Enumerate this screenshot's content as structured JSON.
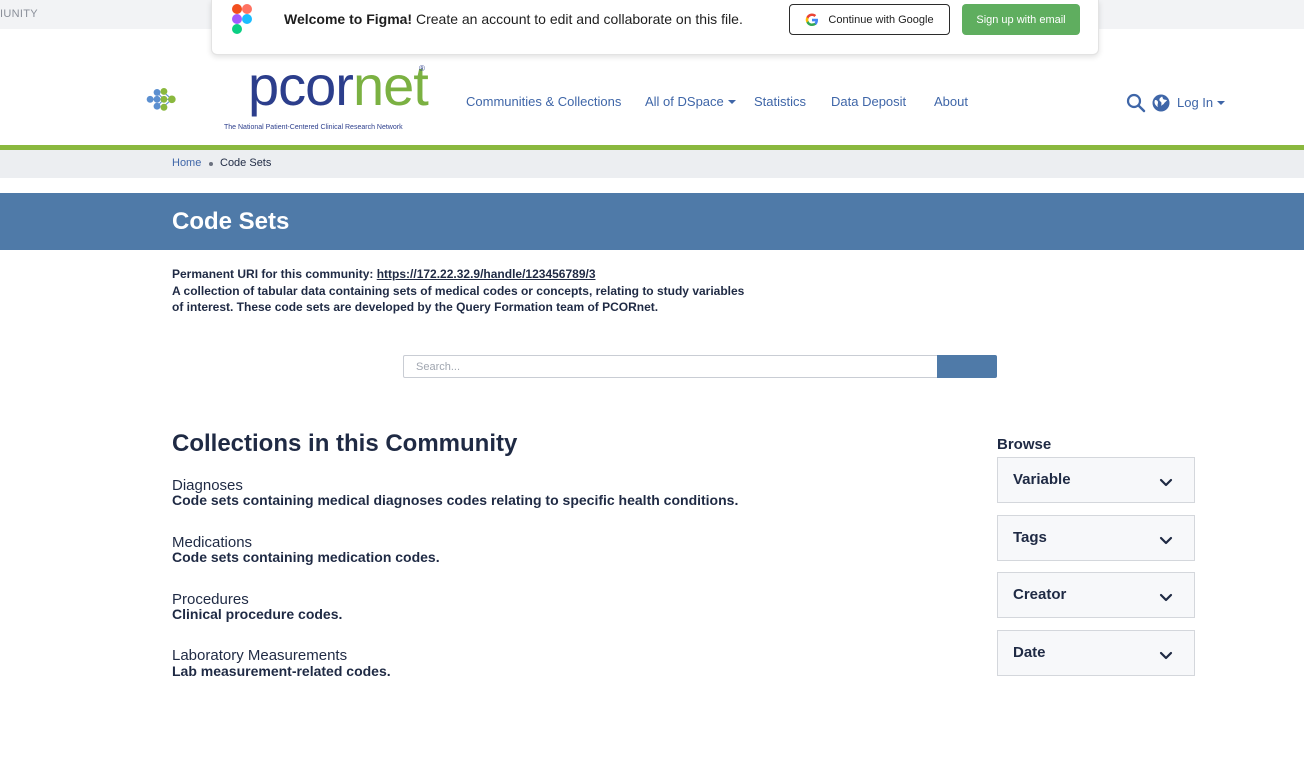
{
  "top_strip": {
    "text": "IUNITY"
  },
  "figma_banner": {
    "title": "Welcome to Figma!",
    "message": "Create an account to edit and collaborate on this file.",
    "google_button": "Continue with Google",
    "email_button": "Sign up with email",
    "accent": "#5fae5f"
  },
  "logo": {
    "word_main": "pcor",
    "word_accent": "net",
    "registered": "®",
    "tagline": "The National Patient-Centered Clinical Research Network"
  },
  "nav": {
    "items": [
      {
        "label": "Communities & Collections",
        "dropdown": false
      },
      {
        "label": "All of DSpace",
        "dropdown": true
      },
      {
        "label": "Statistics",
        "dropdown": false
      },
      {
        "label": "Data Deposit",
        "dropdown": false
      },
      {
        "label": "About",
        "dropdown": false
      }
    ],
    "login": "Log In",
    "icons": [
      "search-icon",
      "globe-icon"
    ]
  },
  "breadcrumb": {
    "home": "Home",
    "current": "Code Sets"
  },
  "page": {
    "title": "Code Sets",
    "uri_label": "Permanent URI for this community:",
    "uri": "https://172.22.32.9/handle/123456789/3",
    "description": "A collection of tabular data containing sets of medical codes or concepts, relating to study variables of interest. These code sets are developed by the Query Formation team of PCORnet."
  },
  "search": {
    "placeholder": "Search...",
    "value": ""
  },
  "collections": {
    "title": "Collections in this Community",
    "items": [
      {
        "name": "Diagnoses",
        "description": "Code sets containing medical diagnoses codes relating to specific health conditions."
      },
      {
        "name": "Medications",
        "description": "Code sets containing medication codes."
      },
      {
        "name": "Procedures",
        "description": "Clinical procedure codes."
      },
      {
        "name": "Laboratory Measurements",
        "description": "Lab measurement-related codes."
      }
    ]
  },
  "browse": {
    "title": "Browse",
    "items": [
      "Variable",
      "Tags",
      "Creator",
      "Date"
    ]
  },
  "colors": {
    "brand_blue": "#2c3e8c",
    "brand_green": "#7bb142",
    "link": "#3f66a8",
    "title_band": "#4f7aa8",
    "green_bar": "#8ab83e"
  }
}
